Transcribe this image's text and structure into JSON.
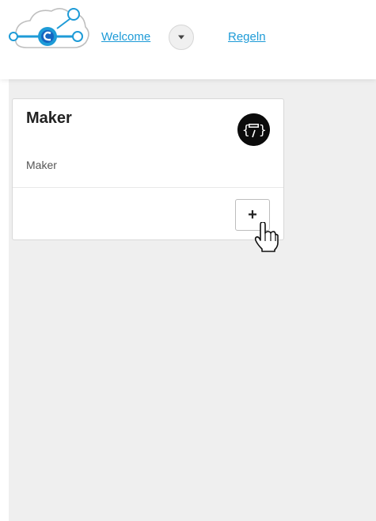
{
  "nav": {
    "welcome_label": "Welcome",
    "regeln_label": "Regeln"
  },
  "card": {
    "title": "Maker",
    "subtitle": "Maker",
    "add_label": "+"
  },
  "icons": {
    "logo": "cloud-network-logo",
    "dropdown": "chevron-down-icon",
    "card_icon": "json-badge-icon",
    "cursor": "hand-pointer-cursor"
  },
  "colors": {
    "link": "#1e9bd7",
    "logo_blue": "#1e9bd7",
    "logo_dark": "#1565c0",
    "content_bg": "#efefef"
  }
}
